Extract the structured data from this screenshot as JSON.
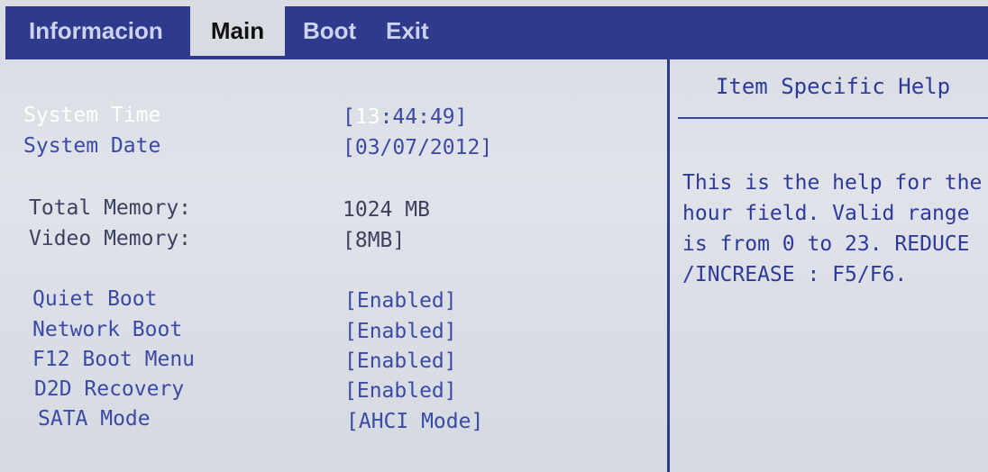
{
  "menu": {
    "tabs": [
      {
        "label": "Informacion"
      },
      {
        "label": "Main"
      },
      {
        "label": "Boot"
      },
      {
        "label": "Exit"
      }
    ]
  },
  "main": {
    "system_time": {
      "label": "System Time",
      "value_open": "[",
      "value_hour": "13",
      "value_rest": ":44:49]"
    },
    "system_date": {
      "label": "System Date",
      "value": "[03/07/2012]"
    },
    "total_memory": {
      "label": "Total Memory:",
      "value": "1024 MB"
    },
    "video_memory": {
      "label": "Video Memory:",
      "value": "[8MB]"
    },
    "quiet_boot": {
      "label": "Quiet Boot",
      "value": "[Enabled]"
    },
    "network_boot": {
      "label": "Network Boot",
      "value": "[Enabled]"
    },
    "f12_boot_menu": {
      "label": "F12 Boot Menu",
      "value": "[Enabled]"
    },
    "d2d_recovery": {
      "label": "D2D Recovery",
      "value": "[Enabled]"
    },
    "sata_mode": {
      "label": "SATA Mode",
      "value": "[AHCI Mode]"
    }
  },
  "help": {
    "title": "Item Specific Help",
    "text": "This is the help for the\nhour field. Valid range\nis from 0 to 23. REDUCE\n/INCREASE : F5/F6."
  },
  "colors": {
    "menubar": "#2e3a8c",
    "item_text": "#3b4aa6",
    "selected_text": "#ffffff",
    "background": "#dcdfe5"
  }
}
